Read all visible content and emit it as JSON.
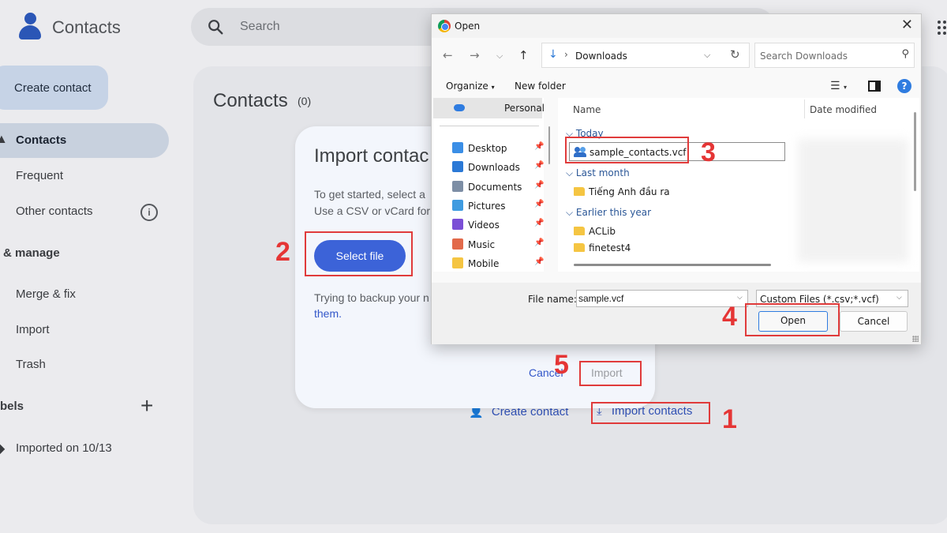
{
  "app": {
    "title": "Contacts",
    "search_placeholder": "Search"
  },
  "sidebar": {
    "create_label": "Create contact",
    "items": [
      {
        "label": "Contacts"
      },
      {
        "label": "Frequent"
      },
      {
        "label": "Other contacts"
      }
    ],
    "manage_heading": "& manage",
    "manage_items": [
      {
        "label": "Merge & fix"
      },
      {
        "label": "Import"
      },
      {
        "label": "Trash"
      }
    ],
    "labels_heading": "bels",
    "label_items": [
      {
        "label": "Imported on 10/13"
      }
    ]
  },
  "main": {
    "title": "Contacts",
    "count": "(0)",
    "create_contact_link": "Create contact",
    "import_contacts_link": "Import contacts"
  },
  "import_dialog": {
    "title": "Import contac",
    "desc_line1": "To get started, select a",
    "desc_line2": "Use a CSV or vCard for",
    "select_file": "Select file",
    "backup_line1": "Trying to backup your n",
    "backup_link": "them.",
    "cancel": "Cancel",
    "import": "Import"
  },
  "open_dialog": {
    "title": "Open",
    "address_path": "Downloads",
    "search_placeholder": "Search Downloads",
    "organize": "Organize",
    "new_folder": "New folder",
    "nav_top": "Personal",
    "quick_access": [
      {
        "label": "Desktop",
        "color": "#3a8ee6"
      },
      {
        "label": "Downloads",
        "color": "#2b79d6"
      },
      {
        "label": "Documents",
        "color": "#7d8ea5"
      },
      {
        "label": "Pictures",
        "color": "#3f9be0"
      },
      {
        "label": "Videos",
        "color": "#7b4fd6"
      },
      {
        "label": "Music",
        "color": "#e26a4b"
      },
      {
        "label": "Mobile",
        "color": "#f5c542"
      }
    ],
    "columns": {
      "name": "Name",
      "date": "Date modified"
    },
    "groups": [
      {
        "label": "Today",
        "files": [
          "sample_contacts.vcf"
        ]
      },
      {
        "label": "Last month",
        "files": [
          "Tiếng Anh đầu ra"
        ]
      },
      {
        "label": "Earlier this year",
        "files": [
          "ACLib",
          "finetest4"
        ]
      }
    ],
    "file_name_label": "File name:",
    "file_name_value": "sample.vcf",
    "file_type": "Custom Files (*.csv;*.vcf)",
    "open_button": "Open",
    "cancel_button": "Cancel"
  },
  "annotations": {
    "steps": [
      "1",
      "2",
      "3",
      "4",
      "5"
    ],
    "color": "#e03b3b"
  }
}
